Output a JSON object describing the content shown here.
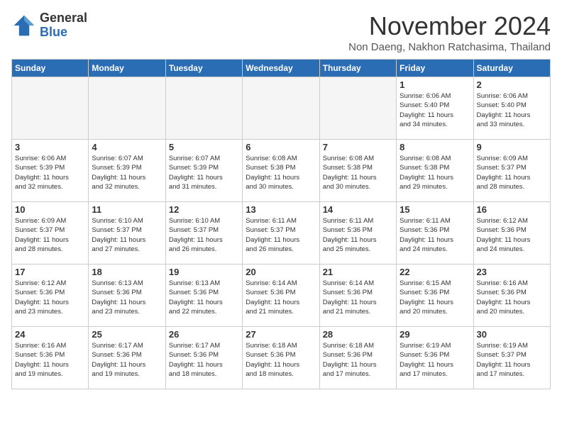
{
  "header": {
    "logo_general": "General",
    "logo_blue": "Blue",
    "month_title": "November 2024",
    "location": "Non Daeng, Nakhon Ratchasima, Thailand"
  },
  "weekdays": [
    "Sunday",
    "Monday",
    "Tuesday",
    "Wednesday",
    "Thursday",
    "Friday",
    "Saturday"
  ],
  "weeks": [
    [
      {
        "day": "",
        "info": ""
      },
      {
        "day": "",
        "info": ""
      },
      {
        "day": "",
        "info": ""
      },
      {
        "day": "",
        "info": ""
      },
      {
        "day": "",
        "info": ""
      },
      {
        "day": "1",
        "info": "Sunrise: 6:06 AM\nSunset: 5:40 PM\nDaylight: 11 hours\nand 34 minutes."
      },
      {
        "day": "2",
        "info": "Sunrise: 6:06 AM\nSunset: 5:40 PM\nDaylight: 11 hours\nand 33 minutes."
      }
    ],
    [
      {
        "day": "3",
        "info": "Sunrise: 6:06 AM\nSunset: 5:39 PM\nDaylight: 11 hours\nand 32 minutes."
      },
      {
        "day": "4",
        "info": "Sunrise: 6:07 AM\nSunset: 5:39 PM\nDaylight: 11 hours\nand 32 minutes."
      },
      {
        "day": "5",
        "info": "Sunrise: 6:07 AM\nSunset: 5:39 PM\nDaylight: 11 hours\nand 31 minutes."
      },
      {
        "day": "6",
        "info": "Sunrise: 6:08 AM\nSunset: 5:38 PM\nDaylight: 11 hours\nand 30 minutes."
      },
      {
        "day": "7",
        "info": "Sunrise: 6:08 AM\nSunset: 5:38 PM\nDaylight: 11 hours\nand 30 minutes."
      },
      {
        "day": "8",
        "info": "Sunrise: 6:08 AM\nSunset: 5:38 PM\nDaylight: 11 hours\nand 29 minutes."
      },
      {
        "day": "9",
        "info": "Sunrise: 6:09 AM\nSunset: 5:37 PM\nDaylight: 11 hours\nand 28 minutes."
      }
    ],
    [
      {
        "day": "10",
        "info": "Sunrise: 6:09 AM\nSunset: 5:37 PM\nDaylight: 11 hours\nand 28 minutes."
      },
      {
        "day": "11",
        "info": "Sunrise: 6:10 AM\nSunset: 5:37 PM\nDaylight: 11 hours\nand 27 minutes."
      },
      {
        "day": "12",
        "info": "Sunrise: 6:10 AM\nSunset: 5:37 PM\nDaylight: 11 hours\nand 26 minutes."
      },
      {
        "day": "13",
        "info": "Sunrise: 6:11 AM\nSunset: 5:37 PM\nDaylight: 11 hours\nand 26 minutes."
      },
      {
        "day": "14",
        "info": "Sunrise: 6:11 AM\nSunset: 5:36 PM\nDaylight: 11 hours\nand 25 minutes."
      },
      {
        "day": "15",
        "info": "Sunrise: 6:11 AM\nSunset: 5:36 PM\nDaylight: 11 hours\nand 24 minutes."
      },
      {
        "day": "16",
        "info": "Sunrise: 6:12 AM\nSunset: 5:36 PM\nDaylight: 11 hours\nand 24 minutes."
      }
    ],
    [
      {
        "day": "17",
        "info": "Sunrise: 6:12 AM\nSunset: 5:36 PM\nDaylight: 11 hours\nand 23 minutes."
      },
      {
        "day": "18",
        "info": "Sunrise: 6:13 AM\nSunset: 5:36 PM\nDaylight: 11 hours\nand 23 minutes."
      },
      {
        "day": "19",
        "info": "Sunrise: 6:13 AM\nSunset: 5:36 PM\nDaylight: 11 hours\nand 22 minutes."
      },
      {
        "day": "20",
        "info": "Sunrise: 6:14 AM\nSunset: 5:36 PM\nDaylight: 11 hours\nand 21 minutes."
      },
      {
        "day": "21",
        "info": "Sunrise: 6:14 AM\nSunset: 5:36 PM\nDaylight: 11 hours\nand 21 minutes."
      },
      {
        "day": "22",
        "info": "Sunrise: 6:15 AM\nSunset: 5:36 PM\nDaylight: 11 hours\nand 20 minutes."
      },
      {
        "day": "23",
        "info": "Sunrise: 6:16 AM\nSunset: 5:36 PM\nDaylight: 11 hours\nand 20 minutes."
      }
    ],
    [
      {
        "day": "24",
        "info": "Sunrise: 6:16 AM\nSunset: 5:36 PM\nDaylight: 11 hours\nand 19 minutes."
      },
      {
        "day": "25",
        "info": "Sunrise: 6:17 AM\nSunset: 5:36 PM\nDaylight: 11 hours\nand 19 minutes."
      },
      {
        "day": "26",
        "info": "Sunrise: 6:17 AM\nSunset: 5:36 PM\nDaylight: 11 hours\nand 18 minutes."
      },
      {
        "day": "27",
        "info": "Sunrise: 6:18 AM\nSunset: 5:36 PM\nDaylight: 11 hours\nand 18 minutes."
      },
      {
        "day": "28",
        "info": "Sunrise: 6:18 AM\nSunset: 5:36 PM\nDaylight: 11 hours\nand 17 minutes."
      },
      {
        "day": "29",
        "info": "Sunrise: 6:19 AM\nSunset: 5:36 PM\nDaylight: 11 hours\nand 17 minutes."
      },
      {
        "day": "30",
        "info": "Sunrise: 6:19 AM\nSunset: 5:37 PM\nDaylight: 11 hours\nand 17 minutes."
      }
    ]
  ]
}
